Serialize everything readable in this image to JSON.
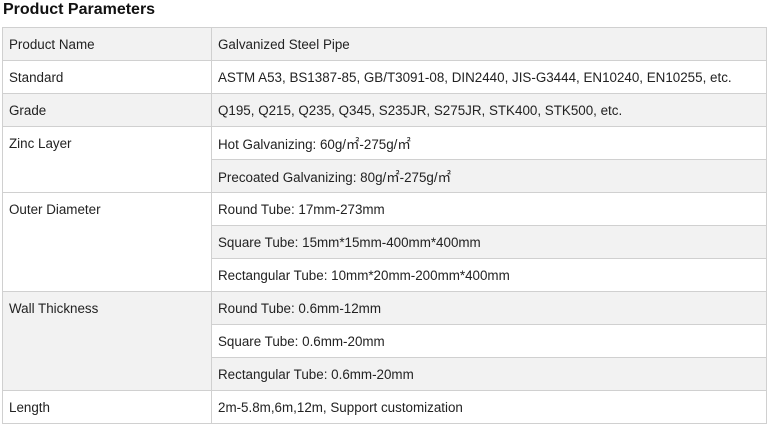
{
  "title": "Product Parameters",
  "rows": {
    "product_name": {
      "label": "Product Name",
      "value": "Galvanized Steel Pipe"
    },
    "standard": {
      "label": "Standard",
      "value": "ASTM A53, BS1387-85, GB/T3091-08, DIN2440, JIS-G3444, EN10240, EN10255, etc."
    },
    "grade": {
      "label": "Grade",
      "value": "Q195, Q215, Q235, Q345, S235JR, S275JR, STK400, STK500, etc."
    },
    "zinc_layer": {
      "label": "Zinc Layer",
      "values": [
        "Hot Galvanizing: 60g/㎡-275g/㎡",
        "Precoated Galvanizing: 80g/㎡-275g/㎡"
      ]
    },
    "outer_diameter": {
      "label": "Outer Diameter",
      "values": [
        "Round Tube: 17mm-273mm",
        "Square Tube: 15mm*15mm-400mm*400mm",
        "Rectangular Tube: 10mm*20mm-200mm*400mm"
      ]
    },
    "wall_thickness": {
      "label": "Wall Thickness",
      "values": [
        "Round Tube: 0.6mm-12mm",
        "Square Tube: 0.6mm-20mm",
        "Rectangular Tube: 0.6mm-20mm"
      ]
    },
    "length": {
      "label": "Length",
      "value": "2m-5.8m,6m,12m, Support customization"
    }
  }
}
